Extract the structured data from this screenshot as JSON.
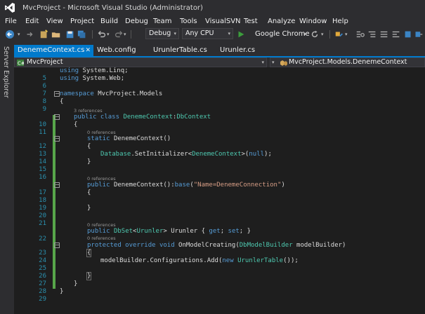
{
  "window": {
    "title": "MvcProject - Microsoft Visual Studio (Administrator)"
  },
  "menu": [
    "File",
    "Edit",
    "View",
    "Project",
    "Build",
    "Debug",
    "Team",
    "Tools",
    "VisualSVN",
    "Test",
    "Analyze",
    "Window",
    "Help"
  ],
  "toolbar": {
    "configuration": "Debug",
    "platform": "Any CPU",
    "browser": "Google Chrome"
  },
  "side_panel": {
    "label": "Server Explorer"
  },
  "tabs": [
    {
      "label": "DenemeContext.cs",
      "active": true
    },
    {
      "label": "Web.config",
      "active": false
    },
    {
      "label": "UrunlerTable.cs",
      "active": false
    },
    {
      "label": "Urunler.cs",
      "active": false
    }
  ],
  "navigation": {
    "project": "MvcProject",
    "type": "MvcProject.Models.DenemeContext"
  },
  "lenses": {
    "class_refs": "3 references",
    "static_ctor_refs": "0 references",
    "ctor_refs": "0 references",
    "dbset_refs": "0 references",
    "method_refs": "0 references"
  },
  "code": {
    "l5": {
      "num": "5",
      "a": "using",
      "b": " System.Linq;"
    },
    "l6": {
      "num": "6",
      "a": "using",
      "b": " System.Web;"
    },
    "l7": {
      "num": "7"
    },
    "l8": {
      "num": "8",
      "a": "namespace",
      "b": " MvcProject.Models"
    },
    "l9": {
      "num": "9",
      "a": "{"
    },
    "l10": {
      "num": "10",
      "a": "public class ",
      "b": "DenemeContext",
      "c": ":",
      "d": "DbContext"
    },
    "l11": {
      "num": "11",
      "a": "{"
    },
    "l12": {
      "num": "12",
      "a": "static ",
      "b": "DenemeContext()"
    },
    "l13": {
      "num": "13",
      "a": "{"
    },
    "l14": {
      "num": "14",
      "a": "Database",
      "b": ".SetInitializer<",
      "c": "DenemeContext",
      "d": ">(",
      "e": "null",
      "f": ");"
    },
    "l15": {
      "num": "15",
      "a": "}"
    },
    "l16": {
      "num": "16"
    },
    "l17": {
      "num": "17",
      "a": "public ",
      "b": "DenemeContext():",
      "c": "base",
      "d": "(",
      "e": "\"Name=DenemeConnection\"",
      "f": ")"
    },
    "l18": {
      "num": "18",
      "a": "{"
    },
    "l19": {
      "num": "19"
    },
    "l20": {
      "num": "20",
      "a": "}"
    },
    "l21": {
      "num": "21"
    },
    "l22": {
      "num": "22",
      "a": "public ",
      "b": "DbSet",
      "c": "<",
      "d": "Urunler",
      "e": "> Urunler { ",
      "f": "get",
      "g": "; ",
      "h": "set",
      "i": "; }"
    },
    "l23": {
      "num": "23",
      "a": "protected override void ",
      "b": "OnModelCreating(",
      "c": "DbModelBuilder",
      "d": " modelBuilder)"
    },
    "l24": {
      "num": "24",
      "a": "{"
    },
    "l25": {
      "num": "25",
      "a": "modelBuilder.Configurations.Add(",
      "b": "new ",
      "c": "UrunlerTable",
      "d": "());"
    },
    "l26": {
      "num": "26"
    },
    "l27": {
      "num": "27",
      "a": "}"
    },
    "l28": {
      "num": "28",
      "a": "}"
    },
    "l29": {
      "num": "29",
      "a": "}"
    }
  }
}
